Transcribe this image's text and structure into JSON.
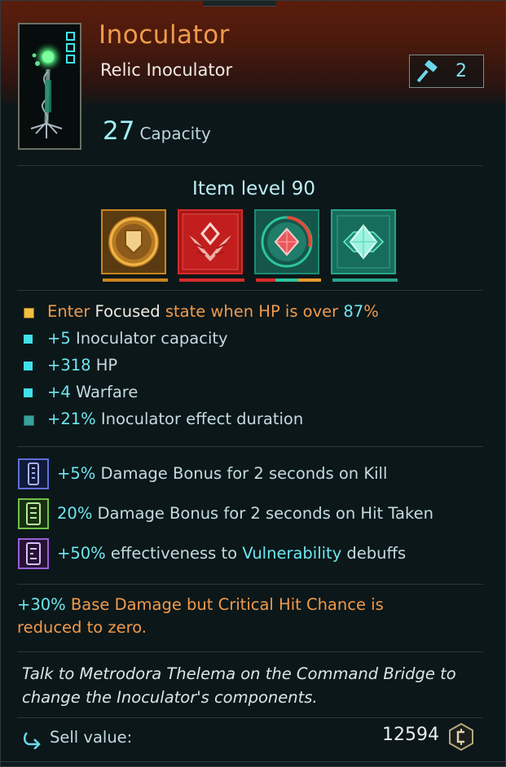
{
  "item": {
    "name": "Inoculator",
    "type": "Relic Inoculator",
    "tier": "2",
    "capacity_value": "27",
    "capacity_label": "Capacity",
    "item_level": "Item level 90"
  },
  "sockets": [
    {
      "name": "shield-component",
      "color": "#e5a12e"
    },
    {
      "name": "winged-emblem-component",
      "color": "#d62b2b"
    },
    {
      "name": "red-gem-component",
      "color": "#2fb98c"
    },
    {
      "name": "green-gem-component",
      "color": "#27a58a"
    }
  ],
  "stats": [
    {
      "parts": [
        "Enter ",
        "Focused",
        " state when HP is over ",
        "87",
        "%"
      ],
      "bullet_color": "#f0c040"
    },
    {
      "parts": [
        "+5",
        " Inoculator capacity"
      ],
      "bullet_color": "#3fe0ea"
    },
    {
      "parts": [
        "+318",
        " HP"
      ],
      "bullet_color": "#3fe0ea"
    },
    {
      "parts": [
        "+4",
        " Warfare"
      ],
      "bullet_color": "#3fe0ea"
    },
    {
      "parts": [
        "+21%",
        " Inoculator effect duration"
      ],
      "bullet_color": "#3aa09a"
    }
  ],
  "traits": [
    {
      "parts": [
        "+5%",
        " Damage Bonus for 2 seconds on Kill"
      ],
      "chip_color": "#5f6fd8"
    },
    {
      "parts": [
        "20%",
        " Damage Bonus for 2 seconds on Hit Taken"
      ],
      "chip_color": "#6fc24a"
    },
    {
      "parts": [
        "+50%",
        " effectiveness to ",
        "Vulnerability",
        " debuffs"
      ],
      "chip_color": "#9a5fd8"
    }
  ],
  "special": {
    "value": "+30%",
    "line1": " Base Damage but Critical Hit Chance is",
    "line2": "reduced to zero."
  },
  "flavor": {
    "line1": "Talk to Metrodora Thelema on the Command Bridge to",
    "line2": "change the Inoculator's components."
  },
  "sell": {
    "label": "Sell value:",
    "value": "12594"
  }
}
